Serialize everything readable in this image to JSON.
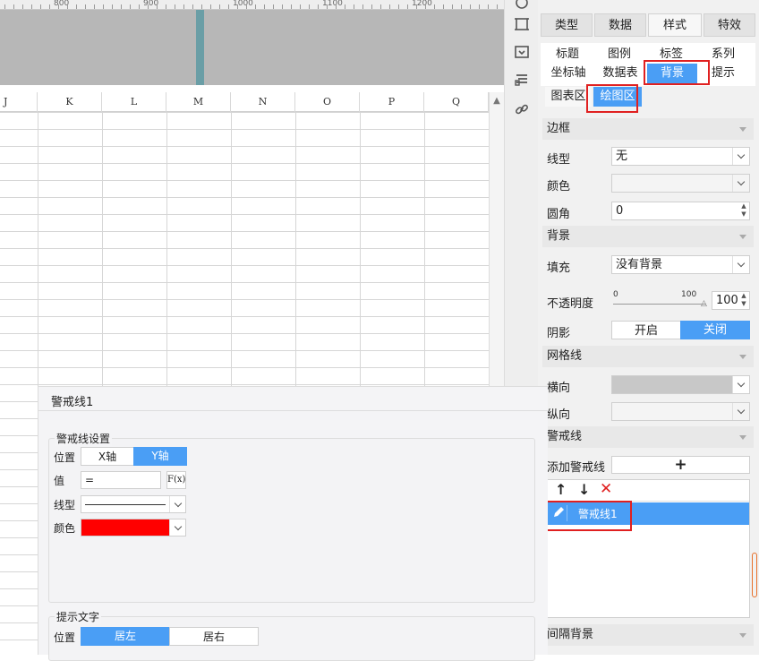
{
  "ruler": {
    "labels": [
      "800",
      "900",
      "1000",
      "1100",
      "1200"
    ]
  },
  "sheet": {
    "columns": [
      "J",
      "K",
      "L",
      "M",
      "N",
      "O",
      "P",
      "Q"
    ]
  },
  "panel": {
    "main_tabs": [
      "类型",
      "数据",
      "样式",
      "特效"
    ],
    "sub_tabs_row1": [
      "标题",
      "图例",
      "标签",
      "系列"
    ],
    "sub_tabs_row2": [
      "坐标轴",
      "数据表",
      "背景",
      "提示"
    ],
    "sub_tabs_row3": [
      "图表区",
      "绘图区"
    ],
    "border": {
      "section": "边框",
      "line_label": "线型",
      "line_value": "无",
      "color_label": "颜色",
      "radius_label": "圆角",
      "radius_value": "0"
    },
    "background": {
      "section": "背景",
      "fill_label": "填充",
      "fill_value": "没有背景",
      "opacity_label": "不透明度",
      "opacity_min": "0",
      "opacity_max": "100",
      "opacity_value": "100",
      "shadow_label": "阴影",
      "shadow_on": "开启",
      "shadow_off": "关闭"
    },
    "gridlines": {
      "section": "网格线",
      "horizontal_label": "横向",
      "vertical_label": "纵向"
    },
    "warning": {
      "section": "警戒线",
      "add_label": "添加警戒线",
      "add_button": "+",
      "items": [
        {
          "label": "警戒线1"
        }
      ]
    },
    "stripe_section": "间隔背景"
  },
  "dialog": {
    "title": "警戒线1",
    "settings_legend": "警戒线设置",
    "position_label": "位置",
    "x_axis": "X轴",
    "y_axis": "Y轴",
    "value_label": "值",
    "value_text": "=",
    "fx_label": "F(x)",
    "line_label": "线型",
    "color_label": "颜色",
    "color_value": "#ff0000",
    "hint_legend": "提示文字",
    "hint_position_label": "位置",
    "align_left": "居左",
    "align_right": "居右"
  },
  "colors": {
    "accent": "#4a9ef5",
    "highlight_box": "#e02020",
    "warning_line_color": "#ff0000"
  }
}
